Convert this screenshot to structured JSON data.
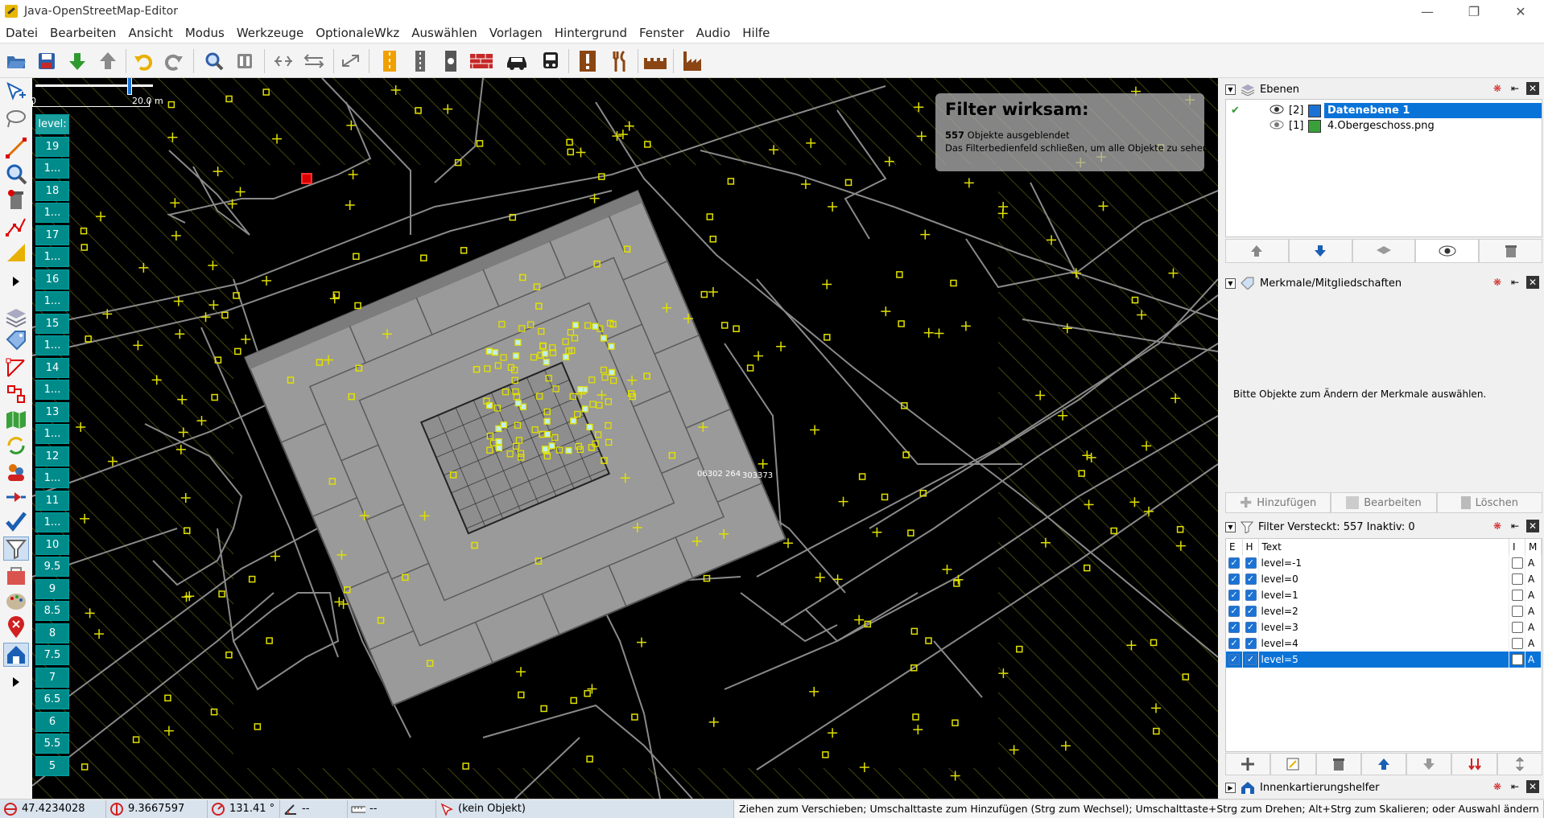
{
  "app": {
    "title": "Java-OpenStreetMap-Editor"
  },
  "menu": [
    "Datei",
    "Bearbeiten",
    "Ansicht",
    "Modus",
    "Werkzeuge",
    "OptionaleWkz",
    "Auswählen",
    "Vorlagen",
    "Hintergrund",
    "Fenster",
    "Audio",
    "Hilfe"
  ],
  "toolbar_icons": [
    "open-icon",
    "save-icon",
    "download-icon",
    "upload-icon",
    "undo-icon",
    "redo-icon",
    "zoom-icon",
    "preferences-icon",
    "split-icon",
    "combine-icon",
    "reverse-icon",
    "road-icon",
    "crossing-icon",
    "traffic-light-icon",
    "wall-icon",
    "car-icon",
    "bus-icon",
    "warning-icon",
    "restaurant-icon",
    "castle-icon",
    "factory-icon"
  ],
  "scale": {
    "start": "0",
    "end": "20.0 m"
  },
  "levels": [
    "level:",
    "19",
    "1...",
    "18",
    "1...",
    "17",
    "1...",
    "16",
    "1...",
    "15",
    "1...",
    "14",
    "1...",
    "13",
    "1...",
    "12",
    "1...",
    "11",
    "1...",
    "10",
    "9.5",
    "9",
    "8.5",
    "8",
    "7.5",
    "7",
    "6.5",
    "6",
    "5.5",
    "5"
  ],
  "map_labels": {
    "label1": "06302 264",
    "label2": "303373"
  },
  "filter_overlay": {
    "title": "Filter wirksam:",
    "count": "557",
    "hidden_text": "Objekte ausgeblendet",
    "hint": "Das Filterbedienfeld schließen, um alle Objekte zu sehen"
  },
  "layers_panel": {
    "title": "Ebenen",
    "layers": [
      {
        "index": "[2]",
        "name": "Datenebene 1",
        "selected": true
      },
      {
        "index": "[1]",
        "name": "4.Obergeschoss.png",
        "selected": false
      }
    ]
  },
  "tags_panel": {
    "title": "Merkmale/Mitgliedschaften",
    "empty_text": "Bitte Objekte zum Ändern der Merkmale auswählen.",
    "add": "Hinzufügen",
    "edit": "Bearbeiten",
    "delete": "Löschen"
  },
  "filter_panel": {
    "title": "Filter Versteckt: 557 Inaktiv: 0",
    "columns": {
      "e": "E",
      "h": "H",
      "text": "Text",
      "i": "I",
      "m": "M"
    },
    "rows": [
      {
        "text": "level=-1",
        "m": "A"
      },
      {
        "text": "level=0",
        "m": "A"
      },
      {
        "text": "level=1",
        "m": "A"
      },
      {
        "text": "level=2",
        "m": "A"
      },
      {
        "text": "level=3",
        "m": "A"
      },
      {
        "text": "level=4",
        "m": "A"
      },
      {
        "text": "level=5",
        "m": "A"
      }
    ]
  },
  "indoor_panel": {
    "title": "Innenkartierungshelfer"
  },
  "status": {
    "lat": "47.4234028",
    "lon": "9.3667597",
    "heading": "131.41 °",
    "angle": "--",
    "length": "--",
    "object": "(kein Objekt)",
    "help": "Ziehen zum Verschieben; Umschalttaste zum Hinzufügen (Strg zum Wechsel); Umschalttaste+Strg zum Drehen; Alt+Strg zum Skalieren; oder Auswahl ändern"
  },
  "colors": {
    "accent": "#0a73d8",
    "level_bg": "#008b8b",
    "map_bg": "#000000",
    "node": "#e0e000"
  }
}
